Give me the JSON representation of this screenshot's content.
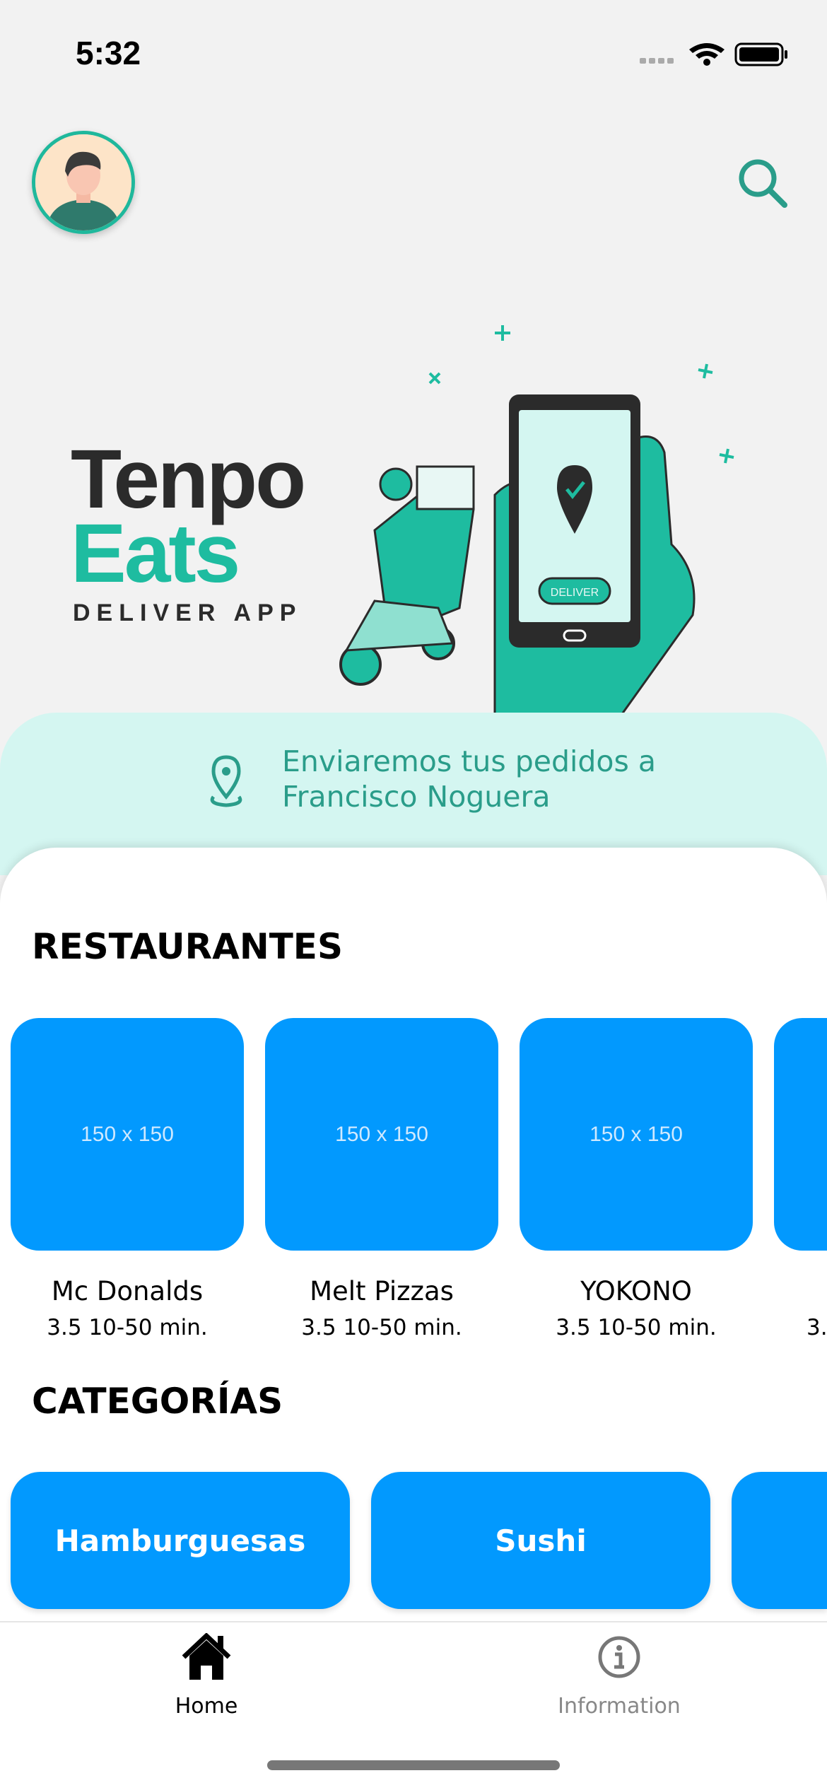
{
  "status_bar": {
    "time": "5:32"
  },
  "header": {
    "avatar": "user-avatar",
    "search_icon": "search-icon"
  },
  "banner": {
    "logo_line1": "Tenpo",
    "logo_line2": "Eats",
    "logo_tagline": "DELIVER APP",
    "illustration_button": "DELIVER"
  },
  "location": {
    "line1": "Enviaremos tus pedidos a",
    "line2": "Francisco Noguera"
  },
  "restaurants": {
    "title": "RESTAURANTES",
    "items": [
      {
        "image": "150 x 150",
        "name": "Mc Donalds",
        "info": "3.5 10-50 min."
      },
      {
        "image": "150 x 150",
        "name": "Melt Pizzas",
        "info": "3.5 10-50 min."
      },
      {
        "image": "150 x 150",
        "name": "YOKONO",
        "info": "3.5 10-50 min."
      },
      {
        "image": "",
        "name": "",
        "info": "3."
      }
    ]
  },
  "categories": {
    "title": "CATEGORÍAS",
    "items": [
      {
        "label": "Hamburguesas"
      },
      {
        "label": "Sushi"
      },
      {
        "label": ""
      }
    ]
  },
  "tabbar": {
    "items": [
      {
        "label": "Home",
        "active": true
      },
      {
        "label": "Information",
        "active": false
      }
    ]
  },
  "colors": {
    "accent": "#1ebca0",
    "card": "#0299fe",
    "location_bg": "#d4f6f1",
    "location_text": "#2a9d8a"
  }
}
